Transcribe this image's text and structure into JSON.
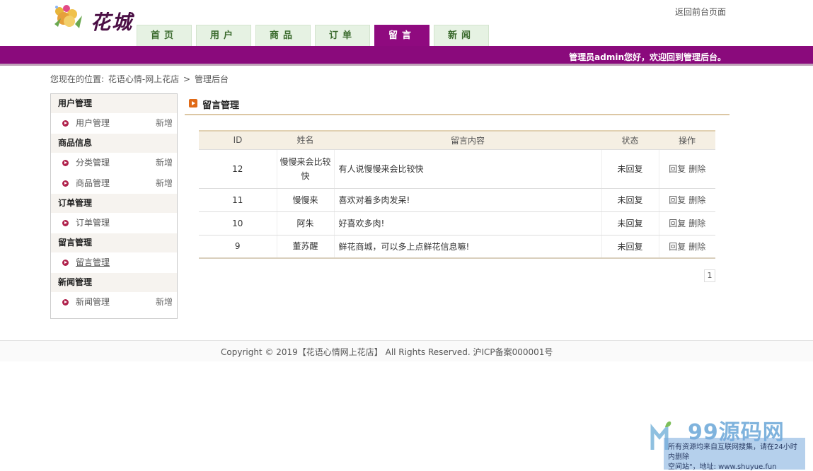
{
  "header": {
    "logo_text": "花城",
    "top_link": "返回前台页面",
    "welcome": "管理员admin您好，欢迎回到管理后台。"
  },
  "nav": {
    "tabs": [
      {
        "label": "首页"
      },
      {
        "label": "用户"
      },
      {
        "label": "商品"
      },
      {
        "label": "订单"
      },
      {
        "label": "留言",
        "active": true
      },
      {
        "label": "新闻"
      }
    ]
  },
  "breadcrumb": {
    "prefix": "您现在的位置:",
    "site": "花语心情-网上花店",
    "sep": ">",
    "current": "管理后台"
  },
  "sidebar": {
    "groups": [
      {
        "title": "用户管理",
        "items": [
          {
            "label": "用户管理",
            "extra": "新增"
          }
        ]
      },
      {
        "title": "商品信息",
        "items": [
          {
            "label": "分类管理",
            "extra": "新增"
          },
          {
            "label": "商品管理",
            "extra": "新增"
          }
        ]
      },
      {
        "title": "订单管理",
        "items": [
          {
            "label": "订单管理",
            "extra": ""
          }
        ]
      },
      {
        "title": "留言管理",
        "items": [
          {
            "label": "留言管理",
            "extra": ""
          }
        ]
      },
      {
        "title": "新闻管理",
        "items": [
          {
            "label": "新闻管理",
            "extra": "新增"
          }
        ]
      }
    ]
  },
  "main": {
    "title": "留言管理",
    "table": {
      "headers": [
        "ID",
        "姓名",
        "留言内容",
        "状态",
        "操作"
      ],
      "rows": [
        {
          "id": "12",
          "name": "慢慢来会比较快",
          "content": "有人说慢慢来会比较快",
          "status": "未回复"
        },
        {
          "id": "11",
          "name": "慢慢来",
          "content": "喜欢对着多肉发呆!",
          "status": "未回复"
        },
        {
          "id": "10",
          "name": "阿朱",
          "content": "好喜欢多肉!",
          "status": "未回复"
        },
        {
          "id": "9",
          "name": "董苏醒",
          "content": "鲜花商城，可以多上点鲜花信息嘛!",
          "status": "未回复"
        }
      ],
      "op_reply": "回复",
      "op_delete": "删除"
    },
    "pager": "1"
  },
  "footer": {
    "text": "Copyright © 2019【花语心情网上花店】 All Rights Reserved. 沪ICP备案000001号"
  },
  "watermark": {
    "brand": "99源码网",
    "line": "所有资源均来自互联网搜集，请在24小时内删除",
    "line2": "空间站\"，地址: www.shuyue.fun"
  }
}
